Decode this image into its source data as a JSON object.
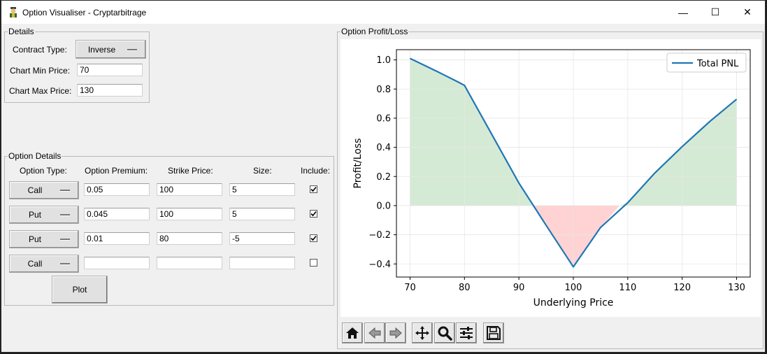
{
  "window": {
    "title": "Option Visualiser - Cryptarbitrage",
    "controls": {
      "minimize": "—",
      "maximize": "☐",
      "close": "✕"
    }
  },
  "details": {
    "legend": "Details",
    "contract_type_label": "Contract Type:",
    "contract_type_value": "Inverse",
    "min_price_label": "Chart Min Price:",
    "min_price_value": "70",
    "max_price_label": "Chart Max Price:",
    "max_price_value": "130"
  },
  "option_details": {
    "legend": "Option Details",
    "headers": {
      "type": "Option Type:",
      "premium": "Option Premium:",
      "strike": "Strike Price:",
      "size": "Size:",
      "include": "Include:"
    },
    "rows": [
      {
        "type": "Call",
        "premium": "0.05",
        "strike": "100",
        "size": "5",
        "include": true
      },
      {
        "type": "Put",
        "premium": "0.045",
        "strike": "100",
        "size": "5",
        "include": true
      },
      {
        "type": "Put",
        "premium": "0.01",
        "strike": "80",
        "size": "-5",
        "include": true
      },
      {
        "type": "Call",
        "premium": "",
        "strike": "",
        "size": "",
        "include": false
      }
    ],
    "plot_label": "Plot"
  },
  "profit_loss": {
    "legend": "Option Profit/Loss"
  },
  "toolbar": {
    "items": [
      "home-icon",
      "back-icon",
      "forward-icon",
      "pan-icon",
      "zoom-icon",
      "configure-subplots-icon",
      "save-icon"
    ]
  },
  "chart_data": {
    "type": "line",
    "title": "",
    "xlabel": "Underlying Price",
    "ylabel": "Profit/Loss",
    "xlim": [
      67.5,
      132.5
    ],
    "ylim": [
      -0.49,
      1.07
    ],
    "xticks": [
      70,
      80,
      90,
      100,
      110,
      120,
      130
    ],
    "yticks": [
      -0.4,
      -0.2,
      0.0,
      0.2,
      0.4,
      0.6,
      0.8,
      1.0
    ],
    "ytick_labels": [
      "−0.4",
      "−0.2",
      "0.0",
      "0.2",
      "0.4",
      "0.6",
      "0.8",
      "1.0"
    ],
    "grid": true,
    "legend_position": "top-right",
    "series": [
      {
        "name": "Total PNL",
        "color": "#1f77b4",
        "x": [
          70,
          75,
          79,
          80,
          85,
          90,
          95,
          100,
          105,
          110,
          115,
          120,
          125,
          130
        ],
        "y": [
          1.01,
          0.92,
          0.845,
          0.825,
          0.49,
          0.155,
          -0.135,
          -0.42,
          -0.15,
          0.02,
          0.225,
          0.405,
          0.575,
          0.73
        ]
      }
    ],
    "fill_positive_color": "#d5ead5",
    "fill_negative_color": "#ffd3d3"
  }
}
